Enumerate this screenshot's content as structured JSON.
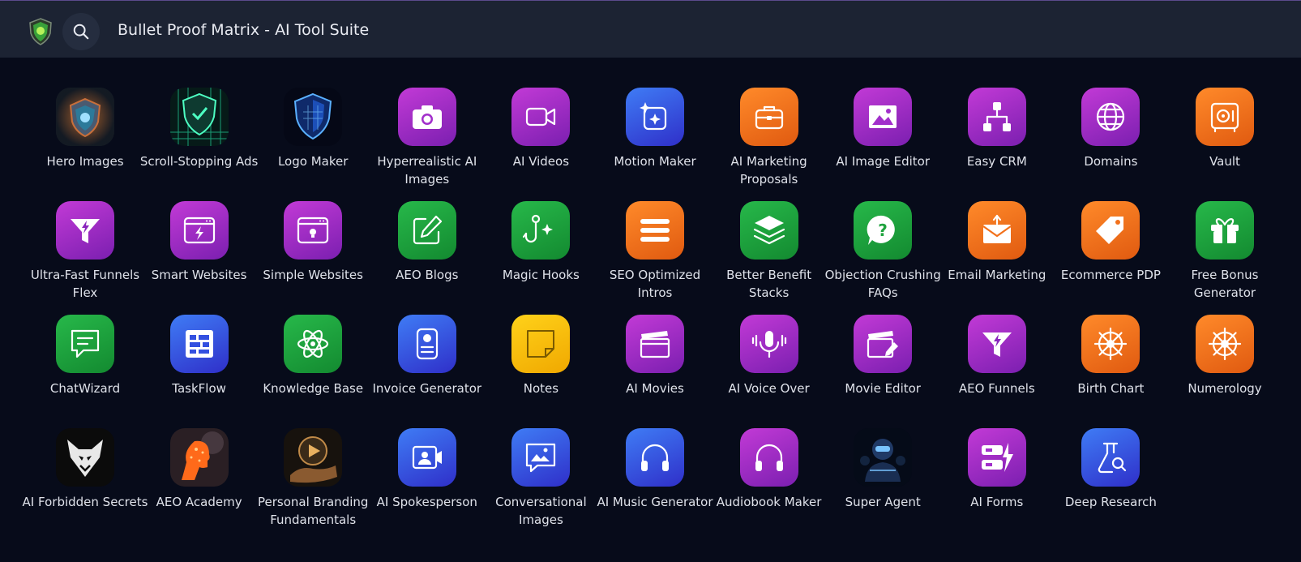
{
  "header": {
    "title": "Bullet Proof Matrix - AI Tool Suite",
    "logo_icon": "shield-logo-icon",
    "search_icon": "search-icon"
  },
  "colors": {
    "background": "#070b1a",
    "topbar": "#1c2333",
    "purple": "#a22fcb",
    "blue": "#3350e0",
    "orange": "#f2711c",
    "green": "#1fa33e",
    "yellow": "#fbbd0c"
  },
  "tools": [
    {
      "label": "Hero Images",
      "icon": "hero-images-icon",
      "color": "photo"
    },
    {
      "label": "Scroll-Stopping Ads",
      "icon": "scroll-stopping-ads-icon",
      "color": "photo"
    },
    {
      "label": "Logo Maker",
      "icon": "logo-maker-icon",
      "color": "photo"
    },
    {
      "label": "Hyperrealistic AI Images",
      "icon": "camera-icon",
      "color": "purple"
    },
    {
      "label": "AI Videos",
      "icon": "video-camera-icon",
      "color": "purple"
    },
    {
      "label": "Motion Maker",
      "icon": "sparkle-frame-icon",
      "color": "blue"
    },
    {
      "label": "AI Marketing Proposals",
      "icon": "briefcase-icon",
      "color": "orange"
    },
    {
      "label": "AI Image Editor",
      "icon": "image-icon",
      "color": "purple"
    },
    {
      "label": "Easy CRM",
      "icon": "org-chart-icon",
      "color": "purple"
    },
    {
      "label": "Domains",
      "icon": "globe-icon",
      "color": "purple"
    },
    {
      "label": "Vault",
      "icon": "safe-icon",
      "color": "orange"
    },
    {
      "label": "Ultra-Fast Funnels Flex",
      "icon": "funnel-bolt-icon",
      "color": "purple"
    },
    {
      "label": "Smart Websites",
      "icon": "browser-bolt-icon",
      "color": "purple"
    },
    {
      "label": "Simple Websites",
      "icon": "browser-bulb-icon",
      "color": "purple"
    },
    {
      "label": "AEO Blogs",
      "icon": "edit-icon",
      "color": "green"
    },
    {
      "label": "Magic Hooks",
      "icon": "hook-sparkle-icon",
      "color": "green"
    },
    {
      "label": "SEO Optimized Intros",
      "icon": "lines-icon",
      "color": "orange"
    },
    {
      "label": "Better Benefit Stacks",
      "icon": "layers-icon",
      "color": "green"
    },
    {
      "label": "Objection Crushing FAQs",
      "icon": "question-bubble-icon",
      "color": "green"
    },
    {
      "label": "Email Marketing",
      "icon": "envelope-icon",
      "color": "orange"
    },
    {
      "label": "Ecommerce PDP",
      "icon": "tag-icon",
      "color": "orange"
    },
    {
      "label": "Free Bonus Generator",
      "icon": "gift-icon",
      "color": "green"
    },
    {
      "label": "ChatWizard",
      "icon": "chat-icon",
      "color": "green"
    },
    {
      "label": "TaskFlow",
      "icon": "table-icon",
      "color": "blue"
    },
    {
      "label": "Knowledge Base",
      "icon": "atom-icon",
      "color": "green"
    },
    {
      "label": "Invoice Generator",
      "icon": "invoice-icon",
      "color": "blue"
    },
    {
      "label": "Notes",
      "icon": "sticky-note-icon",
      "color": "yellow"
    },
    {
      "label": "AI Movies",
      "icon": "clapperboard-icon",
      "color": "purple"
    },
    {
      "label": "AI Voice Over",
      "icon": "microphone-icon",
      "color": "purple"
    },
    {
      "label": "Movie Editor",
      "icon": "clapperboard-edit-icon",
      "color": "purple"
    },
    {
      "label": "AEO Funnels",
      "icon": "funnel-bolt-icon",
      "color": "purple"
    },
    {
      "label": "Birth Chart",
      "icon": "dharma-wheel-icon",
      "color": "orange"
    },
    {
      "label": "Numerology",
      "icon": "dharma-wheel-icon",
      "color": "orange"
    },
    {
      "label": "AI Forbidden Secrets",
      "icon": "wolf-emblem-icon",
      "color": "photo"
    },
    {
      "label": "AEO Academy",
      "icon": "ai-head-icon",
      "color": "photo"
    },
    {
      "label": "Personal Branding Fundamentals",
      "icon": "hand-play-icon",
      "color": "photo"
    },
    {
      "label": "AI Spokesperson",
      "icon": "person-video-icon",
      "color": "blue"
    },
    {
      "label": "Conversational Images",
      "icon": "image-chat-icon",
      "color": "blue"
    },
    {
      "label": "AI Music Generator",
      "icon": "headphones-icon",
      "color": "blue"
    },
    {
      "label": "Audiobook Maker",
      "icon": "headphones-icon",
      "color": "purple"
    },
    {
      "label": "Super Agent",
      "icon": "robot-icon",
      "color": "photo"
    },
    {
      "label": "AI Forms",
      "icon": "form-bolt-icon",
      "color": "purple"
    },
    {
      "label": "Deep Research",
      "icon": "flask-search-icon",
      "color": "blue"
    }
  ]
}
